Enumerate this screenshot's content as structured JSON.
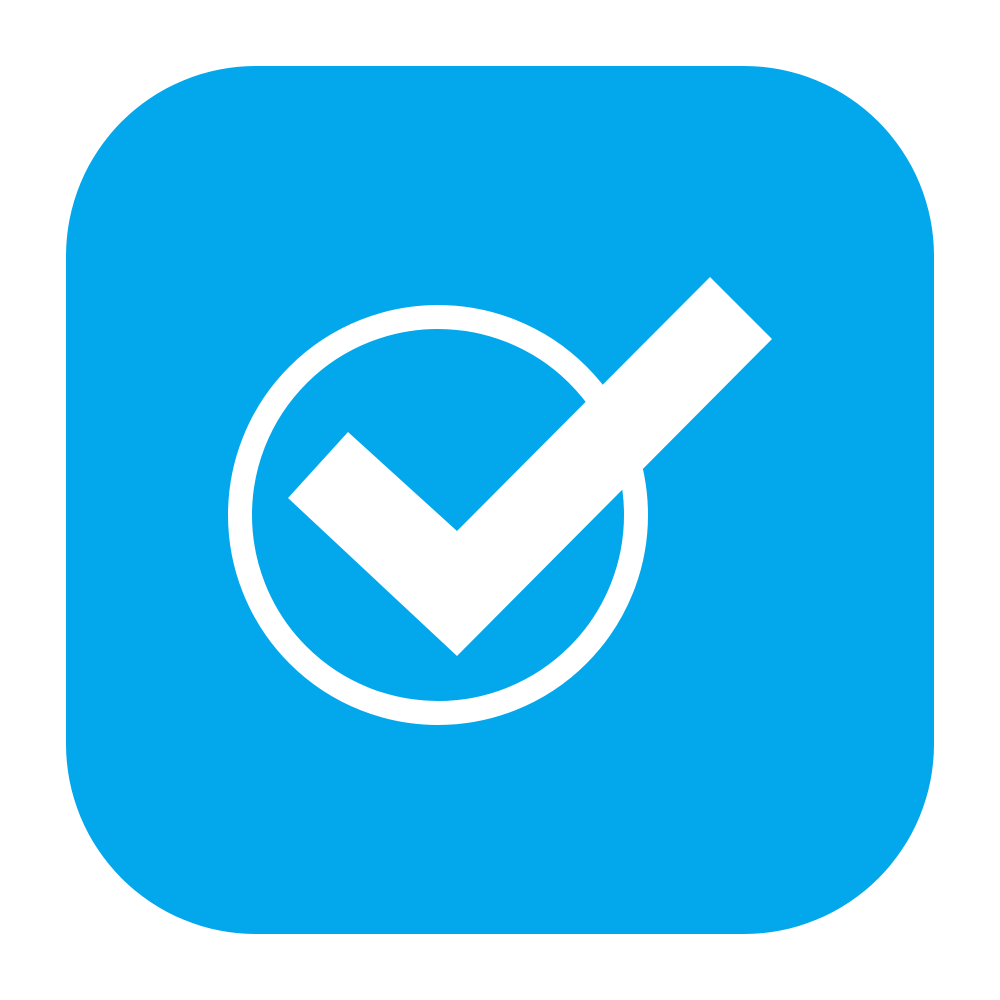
{
  "icon": {
    "name": "check-circle-icon",
    "background_color": "#02a7ec",
    "foreground_color": "#ffffff",
    "page_background": "#ffffff"
  }
}
